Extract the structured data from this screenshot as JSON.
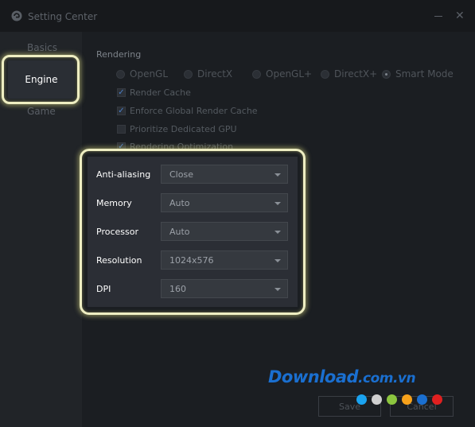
{
  "window": {
    "title": "Setting Center"
  },
  "sidebar": {
    "items": [
      {
        "label": "Basics"
      },
      {
        "label": "Engine",
        "selected": true
      },
      {
        "label": "Game"
      }
    ]
  },
  "rendering": {
    "section_title": "Rendering",
    "modes": [
      {
        "label": "OpenGL",
        "selected": false
      },
      {
        "label": "DirectX",
        "selected": false
      },
      {
        "label": "OpenGL+",
        "selected": false
      },
      {
        "label": "DirectX+",
        "selected": false
      },
      {
        "label": "Smart Mode",
        "selected": true
      }
    ],
    "options": [
      {
        "label": "Render Cache",
        "checked": true
      },
      {
        "label": "Enforce Global Render Cache",
        "checked": true
      },
      {
        "label": "Prioritize Dedicated GPU",
        "checked": false
      },
      {
        "label": "Rendering Optimization",
        "checked": true
      }
    ]
  },
  "engine_settings": {
    "fields": [
      {
        "label": "Anti-aliasing",
        "value": "Close"
      },
      {
        "label": "Memory",
        "value": "Auto"
      },
      {
        "label": "Processor",
        "value": "Auto"
      },
      {
        "label": "Resolution",
        "value": "1024x576"
      },
      {
        "label": "DPI",
        "value": "160"
      }
    ]
  },
  "footer": {
    "save_label": "Save",
    "cancel_label": "Cancel"
  },
  "watermark": {
    "brand": "Download",
    "tld": ".com.vn",
    "dot_colors": [
      "#1aa3f0",
      "#cfcfcf",
      "#8cc63f",
      "#f7a21b",
      "#1a6fd0",
      "#e02020"
    ]
  },
  "colors": {
    "highlight": "#eeeec2",
    "accent": "#4a7ec6",
    "watermark": "#1a6fd0"
  }
}
